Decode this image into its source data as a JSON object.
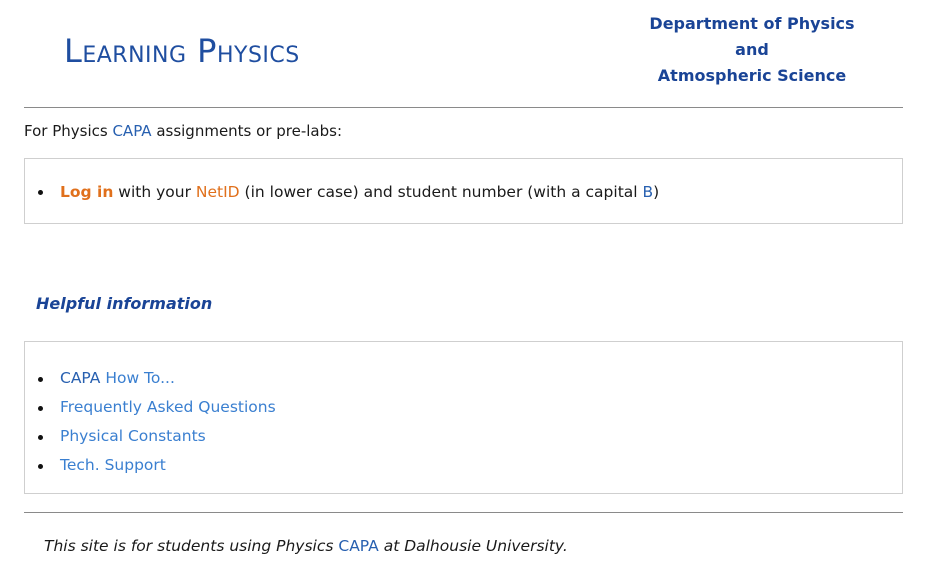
{
  "header": {
    "logo_text": "Learning Physics",
    "dept_line1": "Department of Physics",
    "dept_line2": "and",
    "dept_line3": "Atmospheric Science"
  },
  "intro": {
    "prefix": "For Physics ",
    "capa": "CAPA",
    "suffix": " assignments or pre-labs:"
  },
  "login_box": {
    "login_link": "Log in",
    "text1": " with your ",
    "netid": "NetID",
    "text2": " (in lower case) and student number (with a capital ",
    "capital_b": "B",
    "text3": ")"
  },
  "helpful": {
    "heading": "Helpful information",
    "items": [
      {
        "prefix": "CAPA ",
        "link": "How To..."
      },
      {
        "link": "Frequently Asked Questions"
      },
      {
        "link": "Physical Constants"
      },
      {
        "link": "Tech. Support"
      }
    ]
  },
  "footer": {
    "prefix": "This site is for students using Physics ",
    "capa": "CAPA",
    "suffix": " at Dalhousie University."
  },
  "colors": {
    "dark_blue": "#1a4496",
    "link_blue": "#3a7fd0",
    "orange": "#e0701c",
    "rule_gray": "#8a8a8a"
  }
}
